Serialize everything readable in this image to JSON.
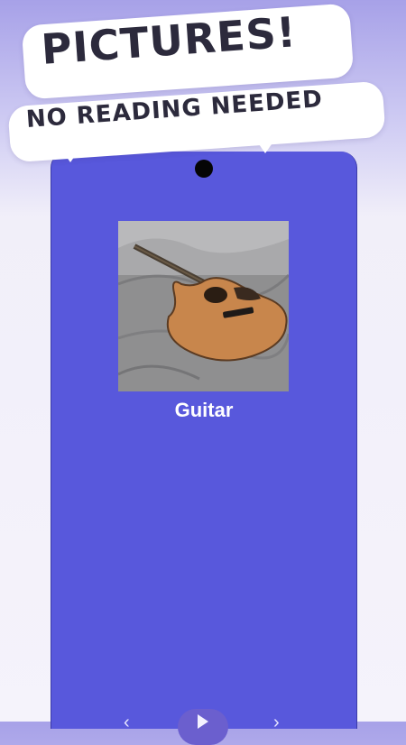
{
  "banner": {
    "headline": "PICTURES!",
    "subheadline": "NO READING NEEDED"
  },
  "card": {
    "image_icon": "guitar-photo",
    "caption": "Guitar"
  },
  "controls": {
    "prev_icon": "chevron-left-icon",
    "play_icon": "play-icon",
    "next_icon": "chevron-right-icon"
  },
  "colors": {
    "screen_background": "#5858dc",
    "caption_text": "#ffffff",
    "headline_text": "#2c2a3c"
  }
}
